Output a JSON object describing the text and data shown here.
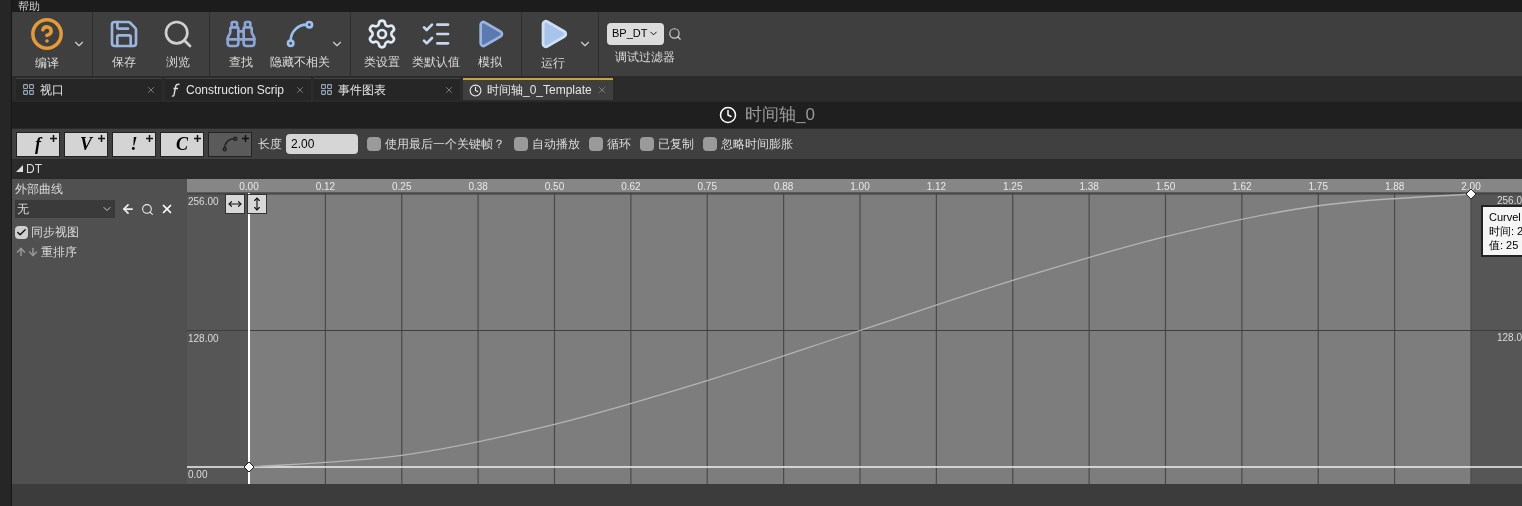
{
  "menu": [
    "帮助"
  ],
  "toolbar_groups": [
    [
      {
        "label": "编译",
        "dropdown": true
      }
    ],
    [
      {
        "label": "保存",
        "dropdown": false
      },
      {
        "label": "浏览",
        "dropdown": false
      }
    ],
    [
      {
        "label": "查找",
        "dropdown": false
      },
      {
        "label": "隐藏不相关",
        "dropdown": true
      }
    ],
    [
      {
        "label": "类设置",
        "dropdown": false
      },
      {
        "label": "类默认值",
        "dropdown": false
      },
      {
        "label": "模拟",
        "dropdown": false
      }
    ],
    [
      {
        "label": "运行",
        "dropdown": true
      }
    ]
  ],
  "debug_filter": {
    "value": "BP_DT",
    "label": "调试过滤器"
  },
  "tabs": [
    {
      "label": "视口",
      "selected": false
    },
    {
      "label": "Construction Scrip",
      "selected": false
    },
    {
      "label": "事件图表",
      "selected": false
    },
    {
      "label": "时间轴_0_Template",
      "selected": true
    }
  ],
  "panel_title": "时间轴_0",
  "add_buttons": [
    {
      "kind": "glyph",
      "glyph": "f",
      "disabled": false
    },
    {
      "kind": "glyph",
      "glyph": "V",
      "disabled": false
    },
    {
      "kind": "glyph",
      "glyph": "!",
      "disabled": false
    },
    {
      "kind": "glyph",
      "glyph": "C",
      "disabled": false
    },
    {
      "kind": "curve",
      "disabled": true
    }
  ],
  "length": {
    "label": "长度",
    "value": "2.00"
  },
  "options": [
    {
      "label": "使用最后一个关键帧？",
      "checked": false
    },
    {
      "label": "自动播放",
      "checked": false
    },
    {
      "label": "循环",
      "checked": false
    },
    {
      "label": "已复制",
      "checked": false
    },
    {
      "label": "忽略时间膨胀",
      "checked": false
    }
  ],
  "track": {
    "expanded": true,
    "external_curve_label": "外部曲线",
    "external_curve_value": "无",
    "sync_view": {
      "label": "同步视图",
      "checked": true
    },
    "reorder_label": "重排序",
    "chart_data": {
      "type": "line",
      "x": [
        0,
        0.25,
        0.5,
        0.75,
        1,
        1.25,
        1.5,
        1.75,
        2
      ],
      "series": [
        {
          "name": "DT",
          "color": "#b4b4b4",
          "values": [
            0,
            11,
            40,
            81,
            128,
            175,
            216,
            245,
            256
          ]
        }
      ],
      "xlim": [
        -0.1015,
        2.0835
      ],
      "ylim": [
        -15.94,
        270.07
      ],
      "grid": true,
      "ref_lines": [
        {
          "axis": "x",
          "value": 0,
          "color": "#ffffff"
        }
      ],
      "xticks": [
        {
          "value": 0,
          "label": "0.00"
        },
        {
          "value": 0.125,
          "label": "0.12"
        },
        {
          "value": 0.25,
          "label": "0.25"
        },
        {
          "value": 0.375,
          "label": "0.38"
        },
        {
          "value": 0.5,
          "label": "0.50"
        },
        {
          "value": 0.625,
          "label": "0.62"
        },
        {
          "value": 0.75,
          "label": "0.75"
        },
        {
          "value": 0.875,
          "label": "0.88"
        },
        {
          "value": 1,
          "label": "1.00"
        },
        {
          "value": 1.125,
          "label": "1.12"
        },
        {
          "value": 1.25,
          "label": "1.25"
        },
        {
          "value": 1.375,
          "label": "1.38"
        },
        {
          "value": 1.5,
          "label": "1.50"
        },
        {
          "value": 1.625,
          "label": "1.62"
        },
        {
          "value": 1.75,
          "label": "1.75"
        },
        {
          "value": 1.875,
          "label": "1.88"
        },
        {
          "value": 2,
          "label": "2.00"
        }
      ],
      "yticks": [
        {
          "value": 0,
          "label": "0.00"
        },
        {
          "value": 128,
          "label": "128.00"
        },
        {
          "value": 256,
          "label": "256.00"
        }
      ]
    },
    "right_axis_labels": [
      "256.0",
      "128.0"
    ],
    "tooltip": [
      "Curvel",
      "时间: 2",
      "值: 25"
    ]
  }
}
